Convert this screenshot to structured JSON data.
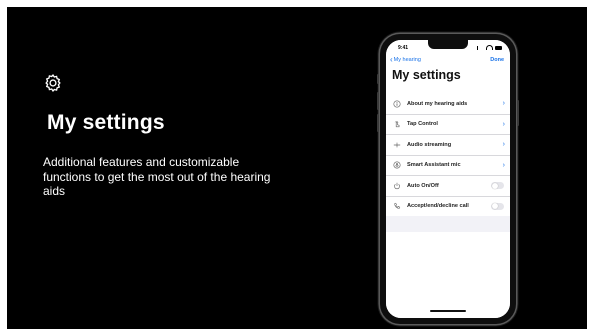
{
  "slide": {
    "title": "My settings",
    "description": "Additional features and customizable functions to get the most out of the hearing aids",
    "icon": "gear-icon",
    "background_color": "#000000",
    "text_color": "#ffffff"
  },
  "phone": {
    "status": {
      "time": "9:41"
    },
    "nav": {
      "back_label": "My hearing",
      "done_label": "Done"
    },
    "page_title": "My settings",
    "accent_color": "#1a73e8",
    "items": [
      {
        "label": "About my hearing aids",
        "icon": "info-icon",
        "control": "chevron"
      },
      {
        "label": "Tap Control",
        "icon": "tap-hand-icon",
        "control": "chevron"
      },
      {
        "label": "Audio streaming",
        "icon": "streaming-icon",
        "control": "chevron"
      },
      {
        "label": "Smart Assistant mic",
        "icon": "mic-icon",
        "control": "chevron"
      },
      {
        "label": "Auto On/Off",
        "icon": "power-icon",
        "control": "toggle",
        "toggle_on": false
      },
      {
        "label": "Accept/end/decline call",
        "icon": "phone-call-icon",
        "control": "toggle",
        "toggle_on": false
      }
    ]
  }
}
